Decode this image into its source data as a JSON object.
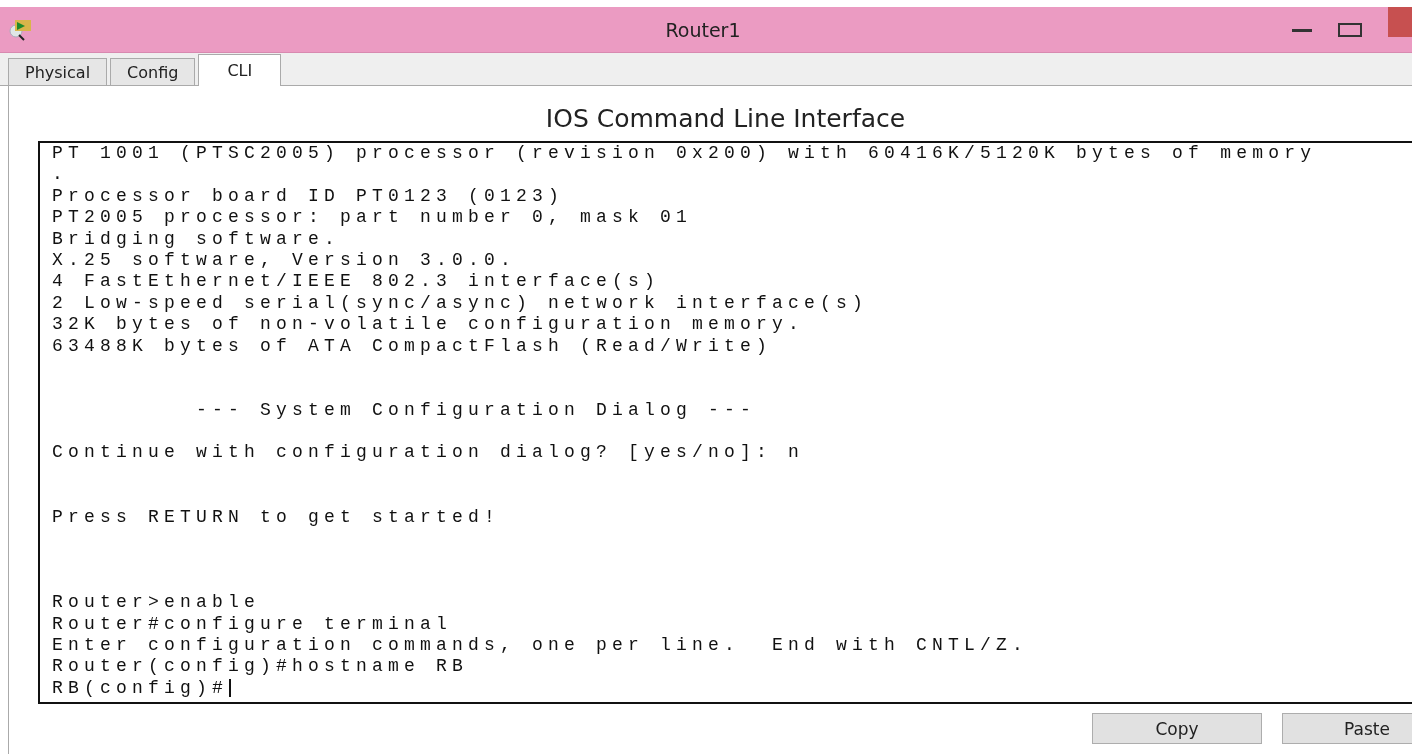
{
  "window": {
    "title": "Router1"
  },
  "tabs": [
    {
      "label": "Physical",
      "selected": false
    },
    {
      "label": "Config",
      "selected": false
    },
    {
      "label": "CLI",
      "selected": true
    }
  ],
  "heading": "IOS Command Line Interface",
  "terminal": {
    "lines": [
      {
        "kind": "text",
        "text": "PT 1001 (PTSC2005) processor (revision 0x200) with 60416K/5120K bytes of memory"
      },
      {
        "kind": "text",
        "text": "."
      },
      {
        "kind": "text",
        "text": "Processor board ID PT0123 (0123)"
      },
      {
        "kind": "text",
        "text": "PT2005 processor: part number 0, mask 01"
      },
      {
        "kind": "text",
        "text": "Bridging software."
      },
      {
        "kind": "text",
        "text": "X.25 software, Version 3.0.0."
      },
      {
        "kind": "text",
        "text": "4 FastEthernet/IEEE 802.3 interface(s)"
      },
      {
        "kind": "text",
        "text": "2 Low-speed serial(sync/async) network interface(s)"
      },
      {
        "kind": "text",
        "text": "32K bytes of non-volatile configuration memory."
      },
      {
        "kind": "text",
        "text": "63488K bytes of ATA CompactFlash (Read/Write)"
      },
      {
        "kind": "blank"
      },
      {
        "kind": "blank"
      },
      {
        "kind": "text",
        "text": "         --- System Configuration Dialog ---"
      },
      {
        "kind": "blank"
      },
      {
        "kind": "text",
        "text": "Continue with configuration dialog? [yes/no]: n"
      },
      {
        "kind": "blank"
      },
      {
        "kind": "blank"
      },
      {
        "kind": "text",
        "text": "Press RETURN to get started!"
      },
      {
        "kind": "blank"
      },
      {
        "kind": "blank"
      },
      {
        "kind": "blank"
      },
      {
        "kind": "text",
        "text": "Router>enable"
      },
      {
        "kind": "text",
        "text": "Router#configure terminal"
      },
      {
        "kind": "text",
        "text": "Enter configuration commands, one per line.  End with CNTL/Z."
      },
      {
        "kind": "text",
        "text": "Router(config)#hostname RB"
      },
      {
        "kind": "prompt",
        "text": "RB(config)#"
      }
    ]
  },
  "buttons": [
    "Copy",
    "Paste"
  ]
}
